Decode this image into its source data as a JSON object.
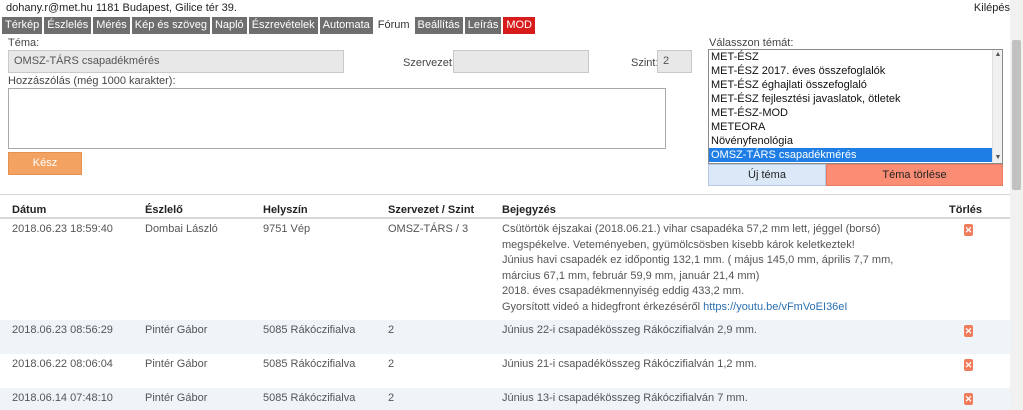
{
  "header": {
    "user": "dohany.r@met.hu  1181 Budapest, Gilice tér 39.",
    "logout": "Kilépés"
  },
  "tabs": [
    {
      "label": "Térkép",
      "active": false
    },
    {
      "label": "Észlelés",
      "active": false
    },
    {
      "label": "Mérés",
      "active": false
    },
    {
      "label": "Kép és szöveg",
      "active": false
    },
    {
      "label": "Napló",
      "active": false
    },
    {
      "label": "Észrevételek",
      "active": false
    },
    {
      "label": "Automata",
      "active": false
    },
    {
      "label": "Fórum",
      "active": true
    },
    {
      "label": "Beállítás",
      "active": false
    },
    {
      "label": "Leírás",
      "active": false
    },
    {
      "label": "MOD",
      "active": false
    }
  ],
  "form": {
    "topic_label": "Téma:",
    "topic_value": "OMSZ-TÁRS csapadékmérés",
    "org_label": "Szervezet:",
    "org_value": "",
    "level_label": "Szint:",
    "level_value": "2",
    "comment_label": "Hozzászólás (még 1000 karakter):",
    "comment_value": "",
    "submit_label": "Kész"
  },
  "topic_picker": {
    "label": "Válasszon témát:",
    "options": [
      "MET-ÉSZ",
      "MET-ÉSZ 2017. éves összefoglalók",
      "MET-ÉSZ éghajlati összefoglaló",
      "MET-ÉSZ fejlesztési javaslatok, ötletek",
      "MET-ÉSZ-MOD",
      "METEORA",
      "Növényfenológia",
      "OMSZ-TÁRS csapadékmérés"
    ],
    "selected": "OMSZ-TÁRS csapadékmérés",
    "new_topic_label": "Új téma",
    "delete_topic_label": "Téma törlése"
  },
  "table": {
    "headers": {
      "date": "Dátum",
      "observer": "Észlelő",
      "location": "Helyszín",
      "org_level": "Szervezet / Szint",
      "entry": "Bejegyzés",
      "delete": "Törlés"
    },
    "rows": [
      {
        "date": "2018.06.23 18:59:40",
        "observer": "Dombai László",
        "location": "9751 Vép",
        "org_level": "OMSZ-TÁRS / 3",
        "entry_lines": [
          "Csütörtök éjszakai (2018.06.21.) vihar csapadéka 57,2 mm lett, jéggel (borsó)",
          "megspékelve. Veteményeben, gyümölcsösben kisebb károk keletkeztek!",
          "Június havi csapadék ez időpontig 132,1 mm. ( május 145,0 mm, április 7,7 mm,",
          "március 67,1 mm, február 59,9 mm, január 21,4 mm)",
          "2018. éves csapadékmennyiség eddig 433,2 mm."
        ],
        "entry_link_prefix": "Gyorsított videó a hidegfront érkezéséről ",
        "entry_link": "https://youtu.be/vFmVoEI36eI"
      },
      {
        "date": "2018.06.23 08:56:29",
        "observer": "Pintér Gábor",
        "location": "5085 Rákócziﬁalva",
        "org_level": "2",
        "entry_lines": [
          "Június 22-i csapadékösszeg Rákócziﬁalván 2,9 mm."
        ]
      },
      {
        "date": "2018.06.22 08:06:04",
        "observer": "Pintér Gábor",
        "location": "5085 Rákócziﬁalva",
        "org_level": "2",
        "entry_lines": [
          "Június 21-i csapadékösszeg Rákócziﬁalván 1,2 mm."
        ]
      },
      {
        "date": "2018.06.14 07:48:10",
        "observer": "Pintér Gábor",
        "location": "5085 Rákócziﬁalva",
        "org_level": "2",
        "entry_lines": [
          "Június 13-i csapadékösszeg Rákócziﬁalván 7 mm."
        ]
      }
    ]
  },
  "colors": {
    "tab_bg": "#6e6e6e",
    "mod_tab": "#d81c1c",
    "submit": "#f4a261",
    "delete_topic": "#fb8d75",
    "new_topic": "#dbe8f7",
    "selected_option": "#1e7ee6",
    "delete_icon": "#f07c5c",
    "link": "#2a6fb0"
  }
}
